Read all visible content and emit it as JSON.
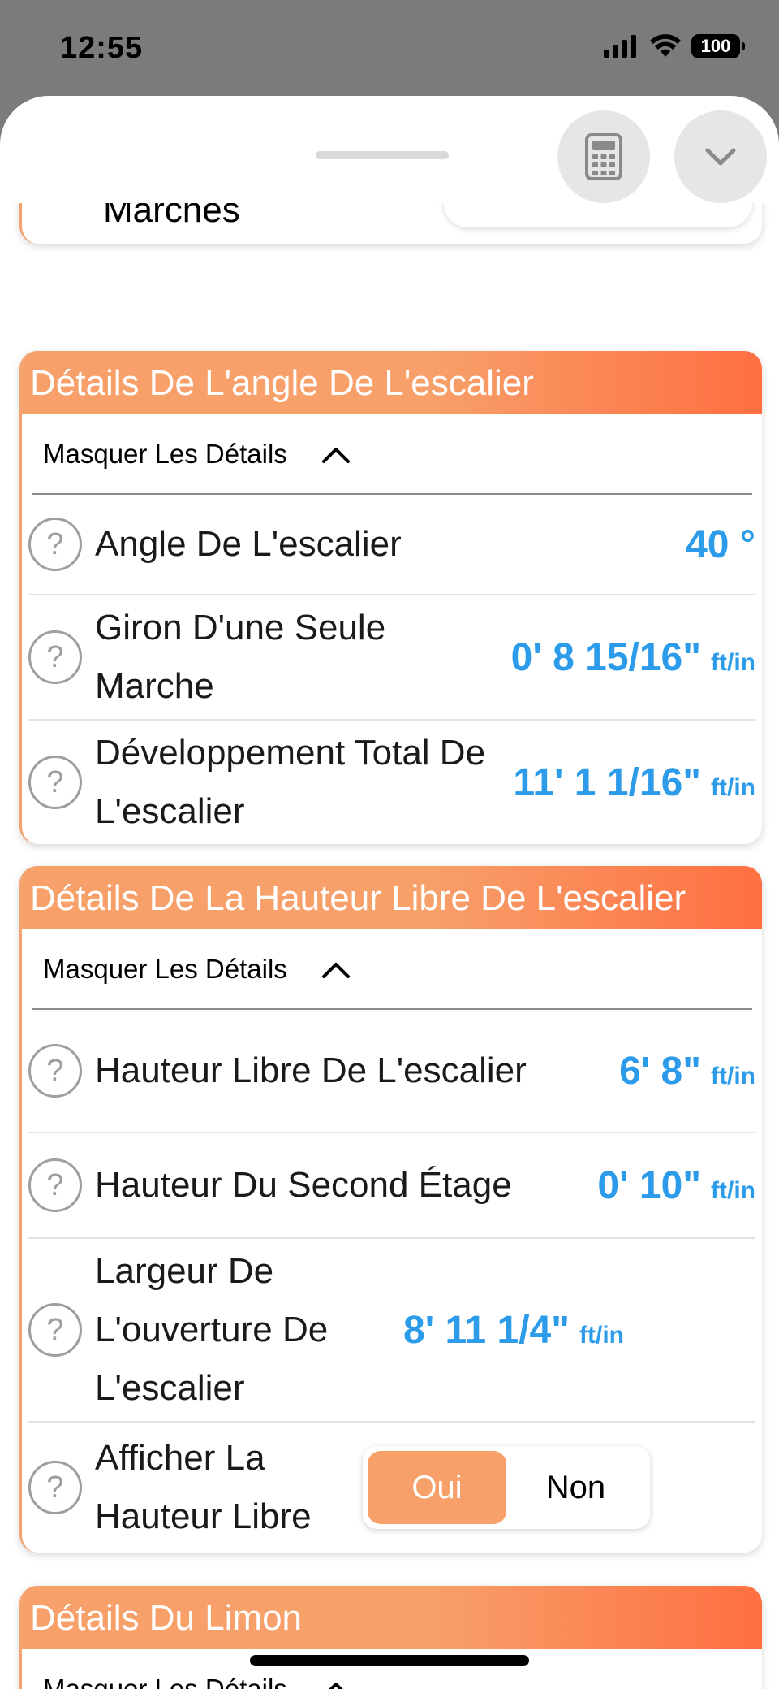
{
  "status": {
    "time": "12:55",
    "battery": "100"
  },
  "top_partial": {
    "label": "Marches"
  },
  "sections": {
    "angle": {
      "title": "Détails De L'angle De L'escalier",
      "toggle_label": "Masquer Les Détails",
      "rows": [
        {
          "label": "Angle De L'escalier",
          "value": "40 °",
          "unit": ""
        },
        {
          "label": "Giron D'une Seule Marche",
          "value": "0' 8 15/16\"",
          "unit": "ft/in"
        },
        {
          "label": "Développement Total De L'escalier",
          "value": "11' 1 1/16\"",
          "unit": "ft/in"
        }
      ]
    },
    "headroom": {
      "title": "Détails De La Hauteur Libre De L'escalier",
      "toggle_label": "Masquer Les Détails",
      "rows": [
        {
          "label": "Hauteur Libre De L'escalier",
          "value": "6' 8\"",
          "unit": "ft/in"
        },
        {
          "label": "Hauteur Du Second Étage",
          "value": "0' 10\"",
          "unit": "ft/in"
        },
        {
          "label": "Largeur De L'ouverture De L'escalier",
          "value": "8' 11 1/4\"",
          "unit": "ft/in"
        }
      ],
      "show_headroom": {
        "label": "Afficher La Hauteur Libre",
        "yes": "Oui",
        "no": "Non",
        "selected": "Oui"
      }
    },
    "stringer": {
      "title": "Détails Du Limon",
      "toggle_label": "Masquer Les Détails"
    }
  },
  "colors": {
    "accent_orange": "#f7a06a",
    "header_gradient_end": "#ff6f41",
    "value_blue": "#2b9bea"
  },
  "icons": [
    "signal-icon",
    "wifi-icon",
    "battery-icon",
    "calculator-icon",
    "chevron-down-icon",
    "chevron-up-icon",
    "help-icon"
  ]
}
